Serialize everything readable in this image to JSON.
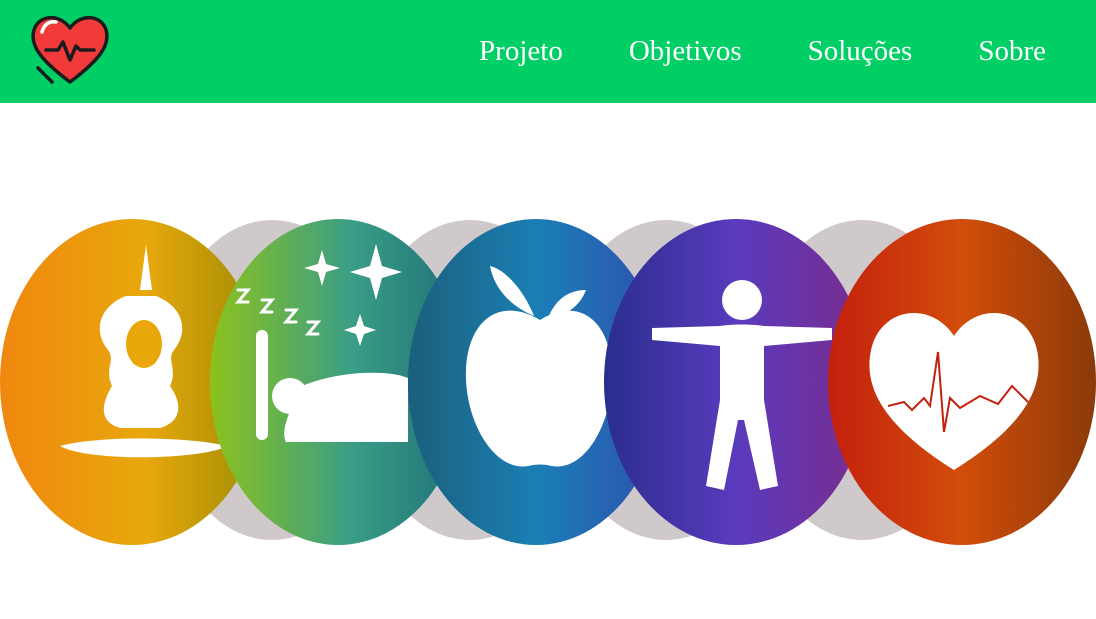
{
  "header": {
    "logo_icon": "heart-pulse-icon",
    "nav": [
      {
        "label": "Projeto"
      },
      {
        "label": "Objetivos"
      },
      {
        "label": "Soluções"
      },
      {
        "label": "Sobre"
      }
    ]
  },
  "hero": {
    "icons": [
      "yoga-meditation-icon",
      "sleep-icon",
      "apple-nutrition-icon",
      "human-body-icon",
      "heart-cardio-icon"
    ]
  },
  "colors": {
    "navbar": "#00cf66",
    "nav_text": "#ffffff",
    "logo_heart": "#f23a3a"
  }
}
